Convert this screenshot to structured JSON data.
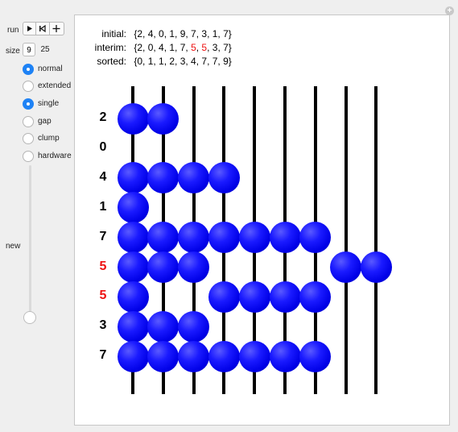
{
  "controls": {
    "run_label": "run",
    "size_label": "size",
    "size_options": [
      "9",
      "25"
    ],
    "size_selected": "9",
    "modes": [
      {
        "label": "normal",
        "selected": true
      },
      {
        "label": "extended",
        "selected": false
      },
      {
        "label": "single",
        "selected": true
      },
      {
        "label": "gap",
        "selected": false
      },
      {
        "label": "clump",
        "selected": false
      },
      {
        "label": "hardware",
        "selected": false
      }
    ],
    "new_label": "new",
    "slider_value": 0
  },
  "lists": {
    "initial_label": "initial:",
    "initial_value": "{2, 4, 0, 1, 9, 7, 3, 1, 7}",
    "interim_label": "interim:",
    "interim_prefix": "{2, 0, 4, 1, 7, ",
    "interim_hl1": "5",
    "interim_sep": ", ",
    "interim_hl2": "5",
    "interim_suffix": ", 3, 7}",
    "sorted_label": "sorted:",
    "sorted_value": "{0, 1, 1, 2, 3, 4, 7, 7, 9}"
  },
  "abacus": {
    "row_labels": [
      "2",
      "0",
      "4",
      "1",
      "7",
      "5",
      "5",
      "3",
      "7"
    ],
    "highlighted_rows": [
      5,
      6
    ],
    "rows": [
      [
        0,
        1
      ],
      [],
      [
        0,
        1,
        2,
        3
      ],
      [
        0
      ],
      [
        0,
        1,
        2,
        3,
        4,
        5,
        6
      ],
      [
        0,
        1,
        2,
        7,
        8
      ],
      [
        0,
        3,
        4,
        5,
        6
      ],
      [
        0,
        1,
        2
      ],
      [
        0,
        1,
        2,
        3,
        4,
        5,
        6
      ]
    ],
    "rods": 9,
    "bead_color": "#0000ff",
    "highlight_color": "#e11111"
  }
}
